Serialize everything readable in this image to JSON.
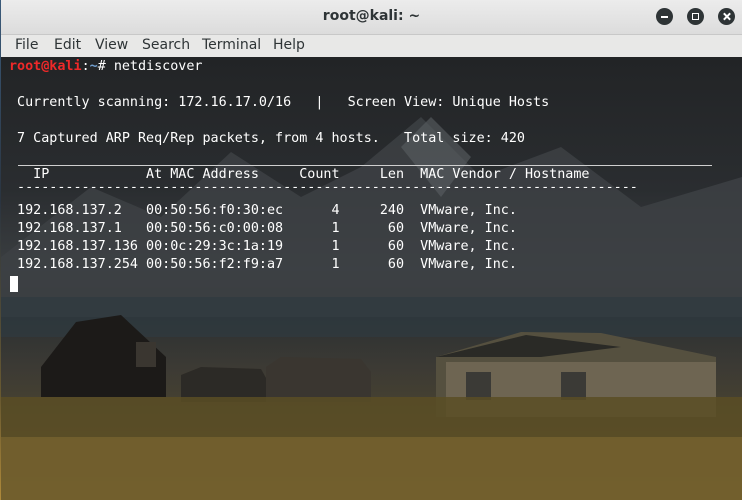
{
  "window": {
    "title": "root@kali: ~"
  },
  "menubar": {
    "items": [
      "File",
      "Edit",
      "View",
      "Search",
      "Terminal",
      "Help"
    ]
  },
  "terminal": {
    "prompt_user": "root@kali",
    "prompt_sep": ":",
    "prompt_path": "~",
    "prompt_symbol": "# ",
    "command": "netdiscover",
    "status_line": " Currently scanning: 172.16.17.0/16   |   Screen View: Unique Hosts",
    "summary_line": " 7 Captured ARP Req/Rep packets, from 4 hosts.   Total size: 420",
    "header_line": "   IP            At MAC Address     Count     Len  MAC Vendor / Hostname",
    "dash_line": " -----------------------------------------------------------------------------",
    "rows": [
      " 192.168.137.2   00:50:56:f0:30:ec      4     240  VMware, Inc.",
      " 192.168.137.1   00:50:56:c0:00:08      1      60  VMware, Inc.",
      " 192.168.137.136 00:0c:29:3c:1a:19      1      60  VMware, Inc.",
      " 192.168.137.254 00:50:56:f2:f9:a7      1      60  VMware, Inc."
    ]
  },
  "hosts": [
    {
      "ip": "192.168.137.2",
      "mac": "00:50:56:f0:30:ec",
      "count": 4,
      "len": 240,
      "vendor": "VMware, Inc."
    },
    {
      "ip": "192.168.137.1",
      "mac": "00:50:56:c0:00:08",
      "count": 1,
      "len": 60,
      "vendor": "VMware, Inc."
    },
    {
      "ip": "192.168.137.136",
      "mac": "00:0c:29:3c:1a:19",
      "count": 1,
      "len": 60,
      "vendor": "VMware, Inc."
    },
    {
      "ip": "192.168.137.254",
      "mac": "00:50:56:f2:f9:a7",
      "count": 1,
      "len": 60,
      "vendor": "VMware, Inc."
    }
  ],
  "colors": {
    "prompt_user": "#ef2929",
    "prompt_path": "#729fcf",
    "text": "#ffffff"
  }
}
